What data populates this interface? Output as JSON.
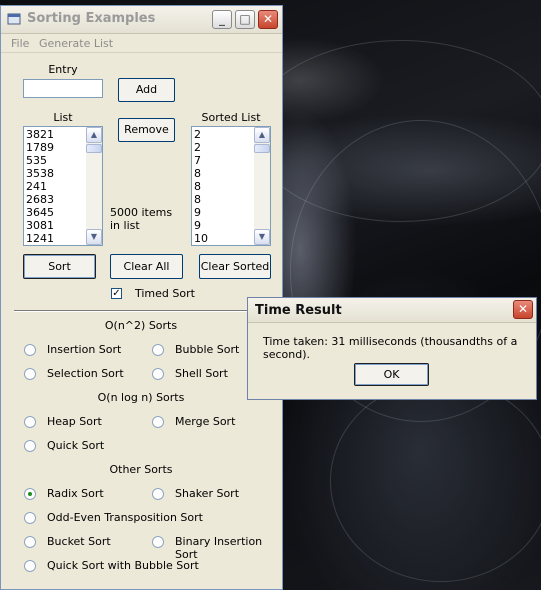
{
  "window": {
    "title": "Sorting Examples",
    "minimize_glyph": "_",
    "maximize_glyph": "□",
    "close_glyph": "✕"
  },
  "menu": {
    "file": "File",
    "generate_list": "Generate List"
  },
  "entry": {
    "label": "Entry",
    "value": ""
  },
  "buttons": {
    "add": "Add",
    "remove": "Remove",
    "sort": "Sort",
    "clear_all": "Clear All",
    "clear_sorted": "Clear Sorted"
  },
  "list": {
    "label": "List",
    "items": [
      "3821",
      "1789",
      "535",
      "3538",
      "241",
      "2683",
      "3645",
      "3081",
      "1241"
    ]
  },
  "sorted_list": {
    "label": "Sorted List",
    "items": [
      "2",
      "2",
      "7",
      "8",
      "8",
      "8",
      "9",
      "9",
      "10"
    ]
  },
  "item_count_text": "5000 items in list",
  "timed_sort": {
    "label": "Timed Sort",
    "checked": true,
    "mark": "✓"
  },
  "groups": {
    "quadratic": "O(n^2) Sorts",
    "nlogn": "O(n log n) Sorts",
    "other": "Other Sorts"
  },
  "sorts": {
    "insertion": "Insertion Sort",
    "bubble": "Bubble Sort",
    "selection": "Selection Sort",
    "shell": "Shell Sort",
    "heap": "Heap Sort",
    "merge": "Merge Sort",
    "quick": "Quick Sort",
    "radix": "Radix Sort",
    "shaker": "Shaker Sort",
    "odd_even": "Odd-Even Transposition Sort",
    "bucket": "Bucket Sort",
    "binary_insertion": "Binary Insertion Sort",
    "quick_bubble": "Quick Sort with Bubble Sort"
  },
  "selected_sort": "radix",
  "dialog": {
    "title": "Time Result",
    "message": "Time taken: 31 milliseconds (thousandths of a second).",
    "ok": "OK",
    "close_glyph": "✕"
  },
  "colors": {
    "window_bg": "#ece9d8",
    "close_button": "#c7452d",
    "radio_selected": "#1f8c21",
    "desktop": "#0c0d10"
  }
}
